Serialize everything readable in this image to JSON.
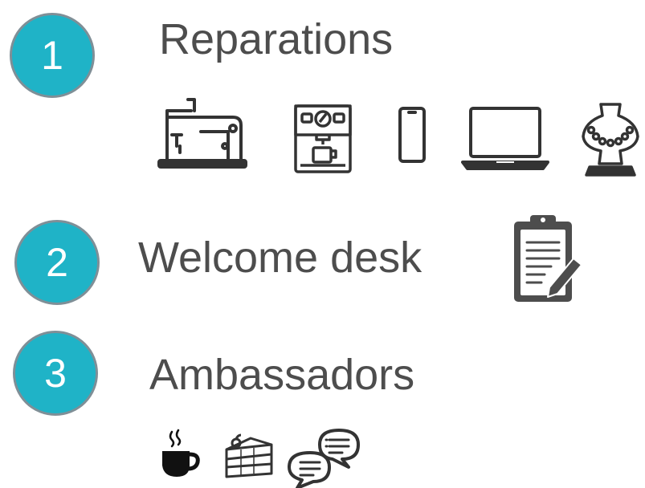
{
  "steps": [
    {
      "number": "1",
      "title": "Reparations"
    },
    {
      "number": "2",
      "title": "Welcome desk"
    },
    {
      "number": "3",
      "title": "Ambassadors"
    }
  ],
  "icons": {
    "reparations": [
      "sewing-machine-icon",
      "coffee-machine-icon",
      "smartphone-icon",
      "laptop-icon",
      "necklace-bust-icon"
    ],
    "welcome_desk": [
      "clipboard-pencil-icon"
    ],
    "ambassadors": [
      "coffee-cup-icon",
      "cake-slice-icon",
      "chat-bubbles-icon"
    ]
  },
  "colors": {
    "circle_fill": "#1fb3c7",
    "circle_border": "#7f8f97",
    "heading_text": "#4d4d4d",
    "icon_stroke": "#333333"
  }
}
